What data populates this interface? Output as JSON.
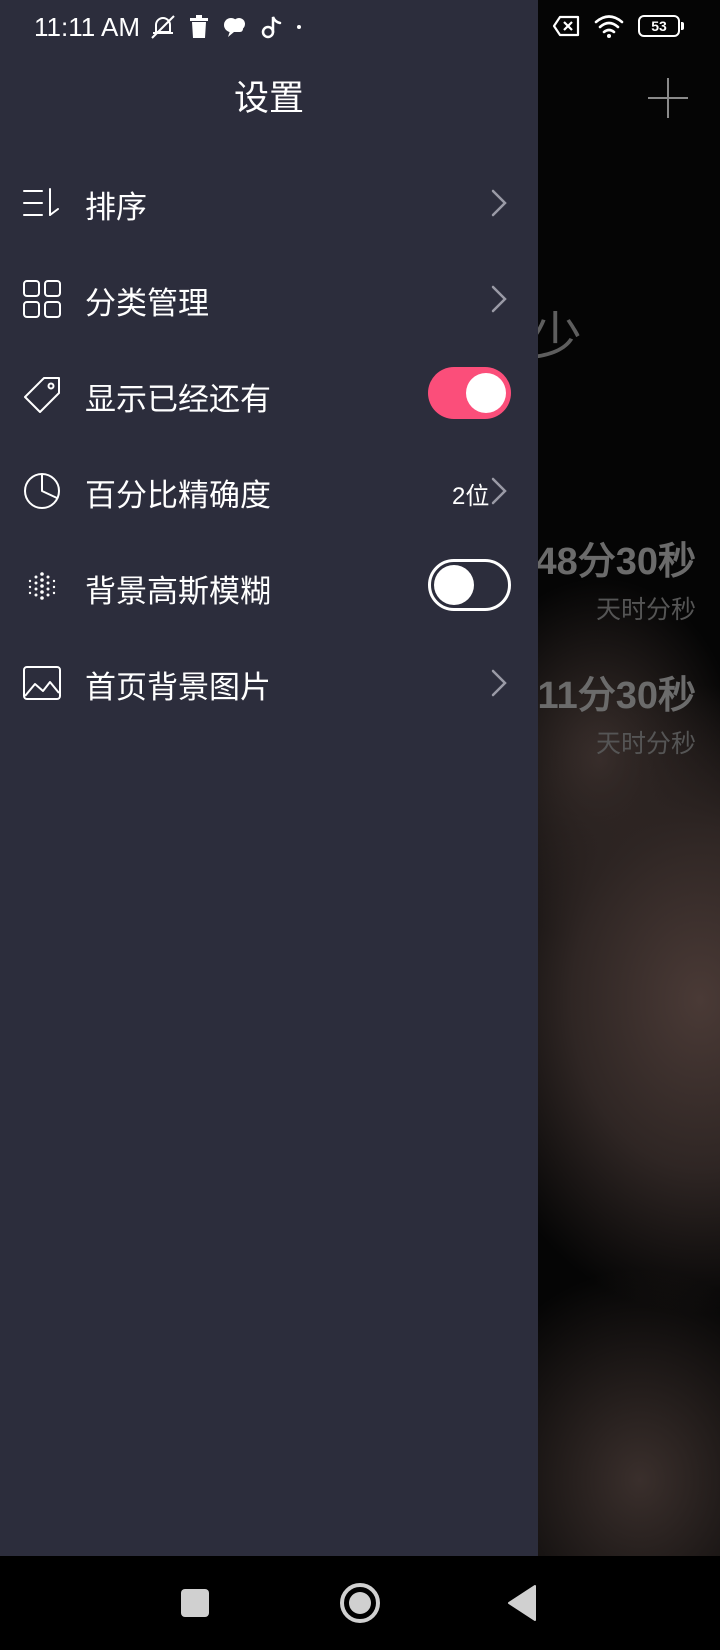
{
  "status_bar": {
    "time": "11:11 AM",
    "battery_level": "53",
    "left_icons": [
      "muted-bell-icon",
      "trash-icon",
      "cloud-chat-icon",
      "tiktok-icon",
      "dot-icon"
    ],
    "right_icons": [
      "sim-x-icon",
      "wifi-icon",
      "battery-icon"
    ]
  },
  "drawer": {
    "title": "设置",
    "items": [
      {
        "label": "排序",
        "icon": "sort-icon",
        "control": "chevron"
      },
      {
        "label": "分类管理",
        "icon": "grid-icon",
        "control": "chevron"
      },
      {
        "label": "显示已经还有",
        "icon": "tag-icon",
        "control": "toggle",
        "toggle_on": true
      },
      {
        "label": "百分比精确度",
        "icon": "pie-chart-icon",
        "control": "chevron",
        "value": "2位"
      },
      {
        "label": "背景高斯模糊",
        "icon": "blur-dots-icon",
        "control": "toggle",
        "toggle_on": false
      },
      {
        "label": "首页背景图片",
        "icon": "image-icon",
        "control": "chevron"
      }
    ]
  },
  "background_app": {
    "partial_char": "少",
    "counters": [
      {
        "value": "48分30秒",
        "unit": "天时分秒"
      },
      {
        "value": "11分30秒",
        "unit": "天时分秒"
      }
    ]
  },
  "colors": {
    "drawer_bg": "#2c2d3c",
    "toggle_on": "#fb4e7a",
    "nav_bg": "#000000"
  },
  "nav_bar": {
    "buttons": [
      "recent-apps-button",
      "home-button",
      "back-button"
    ]
  }
}
